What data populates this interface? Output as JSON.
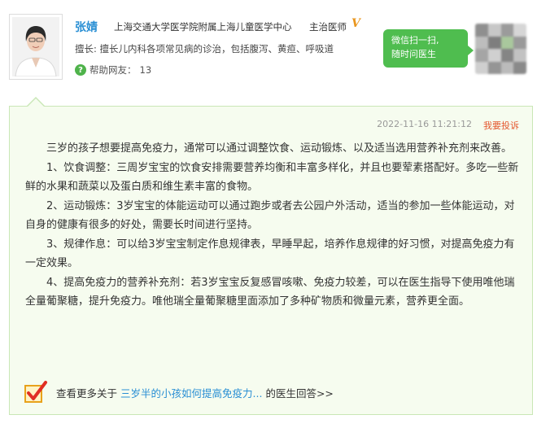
{
  "doctor": {
    "name": "张婧",
    "hospital": "上海交通大学医学院附属上海儿童医学中心",
    "title": "主治医师",
    "verified_badge": "V",
    "specialty": "擅长: 擅长儿内科各项常见病的诊治，包括腹泻、黄疸、呼吸道",
    "helped_label": "帮助网友：",
    "helped_count": "13",
    "help_icon_glyph": "?"
  },
  "wechat": {
    "line1": "微信扫一扫,",
    "line2": "随时问医生"
  },
  "answer": {
    "timestamp": "2022-11-16 11:21:12",
    "complain_label": "我要投诉",
    "paragraphs": [
      "三岁的孩子想要提高免疫力，通常可以通过调整饮食、运动锻炼、以及适当选用营养补充剂来改善。",
      "1、饮食调整：三周岁宝宝的饮食安排需要营养均衡和丰富多样化，并且也要荤素搭配好。多吃一些新鲜的水果和蔬菜以及蛋白质和维生素丰富的食物。",
      "2、运动锻炼：3岁宝宝的体能运动可以通过跑步或者去公园户外活动，适当的参加一些体能运动，对自身的健康有很多的好处，需要长时间进行坚持。",
      "3、规律作息：可以给3岁宝宝制定作息规律表，早睡早起，培养作息规律的好习惯，对提高免疫力有一定效果。",
      "4、提高免疫力的营养补充剂：若3岁宝宝反复感冒咳嗽、免疫力较差，可以在医生指导下使用唯他瑞全量葡聚糖，提升免疫力。唯他瑞全量葡聚糖里面添加了多种矿物质和微量元素，营养更全面。"
    ]
  },
  "more": {
    "prefix": "查看更多关于",
    "link": "三岁半的小孩如何提高免疫力...",
    "suffix": "的医生回答>>"
  },
  "colors": {
    "accent_blue": "#2a8fd4",
    "wechat_green": "#4fbd4f",
    "panel_bg": "#f6fcef",
    "panel_border": "#c9e7b6",
    "complain_red": "#e4572e",
    "badge_orange": "#e9961e"
  },
  "icons": {
    "avatar": "doctor-portrait",
    "verified": "verified-v-icon",
    "help": "question-bubble-icon",
    "qr": "blurred-qr-code",
    "check": "checkmark-box-icon"
  }
}
